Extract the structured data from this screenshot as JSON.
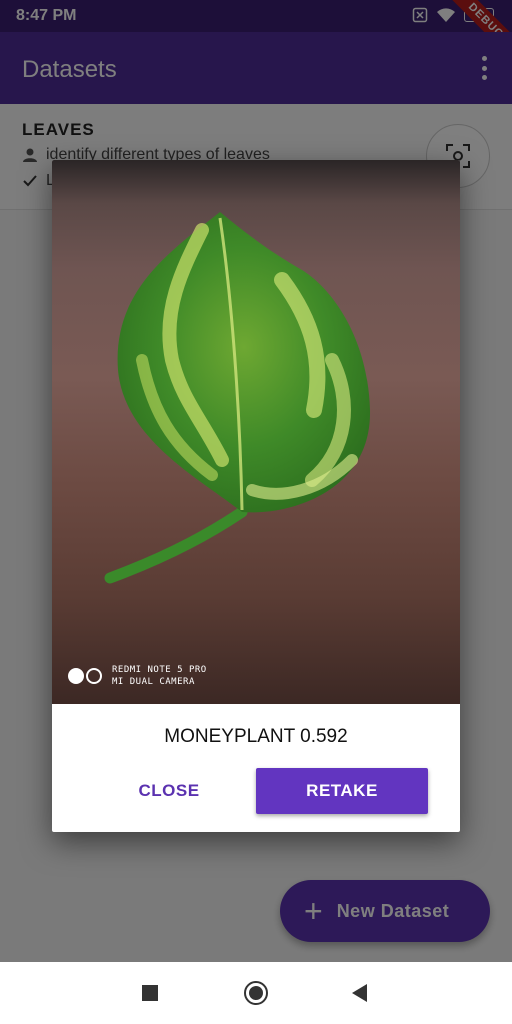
{
  "status_bar": {
    "time": "8:47 PM",
    "battery": "83",
    "debug_label": "DEBUG"
  },
  "app_bar": {
    "title": "Datasets",
    "menu_icon": "more-vert-icon"
  },
  "dataset": {
    "title": "LEAVES",
    "description": "identify different types of leaves",
    "status_partial": "L"
  },
  "dialog": {
    "watermark_line1": "REDMI NOTE 5 PRO",
    "watermark_line2": "MI DUAL CAMERA",
    "result": "MONEYPLANT 0.592",
    "close_label": "CLOSE",
    "retake_label": "RETAKE"
  },
  "fab": {
    "label": "New Dataset"
  },
  "colors": {
    "primary": "#4f2d99",
    "accent": "#6235c0"
  }
}
